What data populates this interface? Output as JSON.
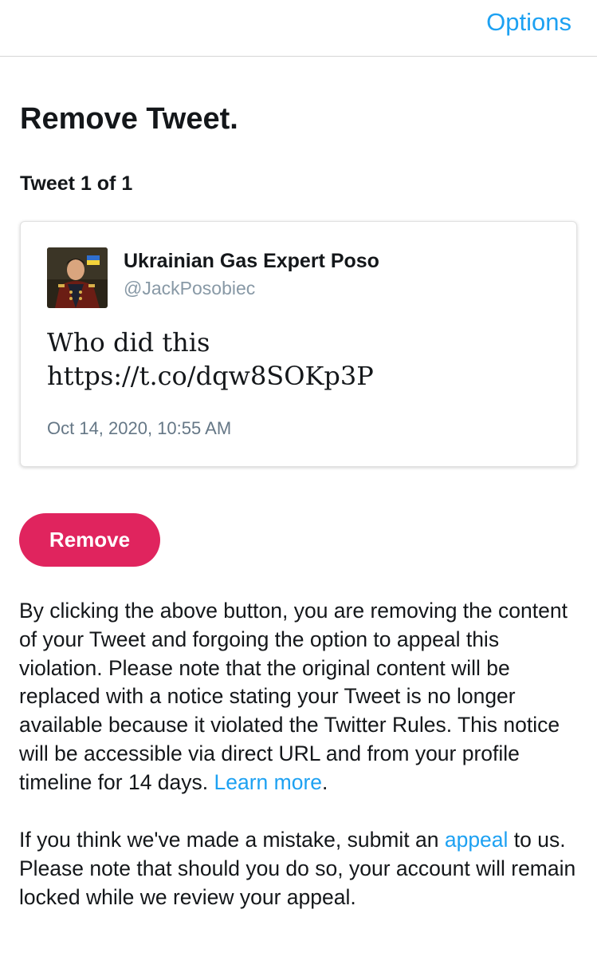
{
  "header": {
    "options_label": "Options"
  },
  "page": {
    "title": "Remove Tweet.",
    "tweet_count": "Tweet 1 of 1"
  },
  "tweet": {
    "author_name": "Ukrainian Gas Expert Poso",
    "author_handle": "@JackPosobiec",
    "text_line1": "Who did this",
    "text_line2": "https://t.co/dqw8SOKp3P",
    "timestamp": "Oct 14, 2020, 10:55 AM",
    "avatar": "portrait-avatar"
  },
  "actions": {
    "remove_label": "Remove"
  },
  "notice": {
    "text": "By clicking the above button, you are removing the content of your Tweet and forgoing the option to appeal this violation. Please note that the original content will be replaced with a notice stating your Tweet is no longer available because it violated the Twitter Rules. This notice will be accessible via direct URL and from your profile timeline for 14 days. ",
    "learn_more_label": "Learn more",
    "end_punct": "."
  },
  "appeal": {
    "text_before": "If you think we've made a mistake, submit an ",
    "link_label": "appeal",
    "text_after": " to us. Please note that should you do so, your account will remain locked while we review your appeal."
  },
  "colors": {
    "link": "#1da1f2",
    "remove_button": "#e0245e",
    "text": "#14171a",
    "muted": "#657786"
  }
}
